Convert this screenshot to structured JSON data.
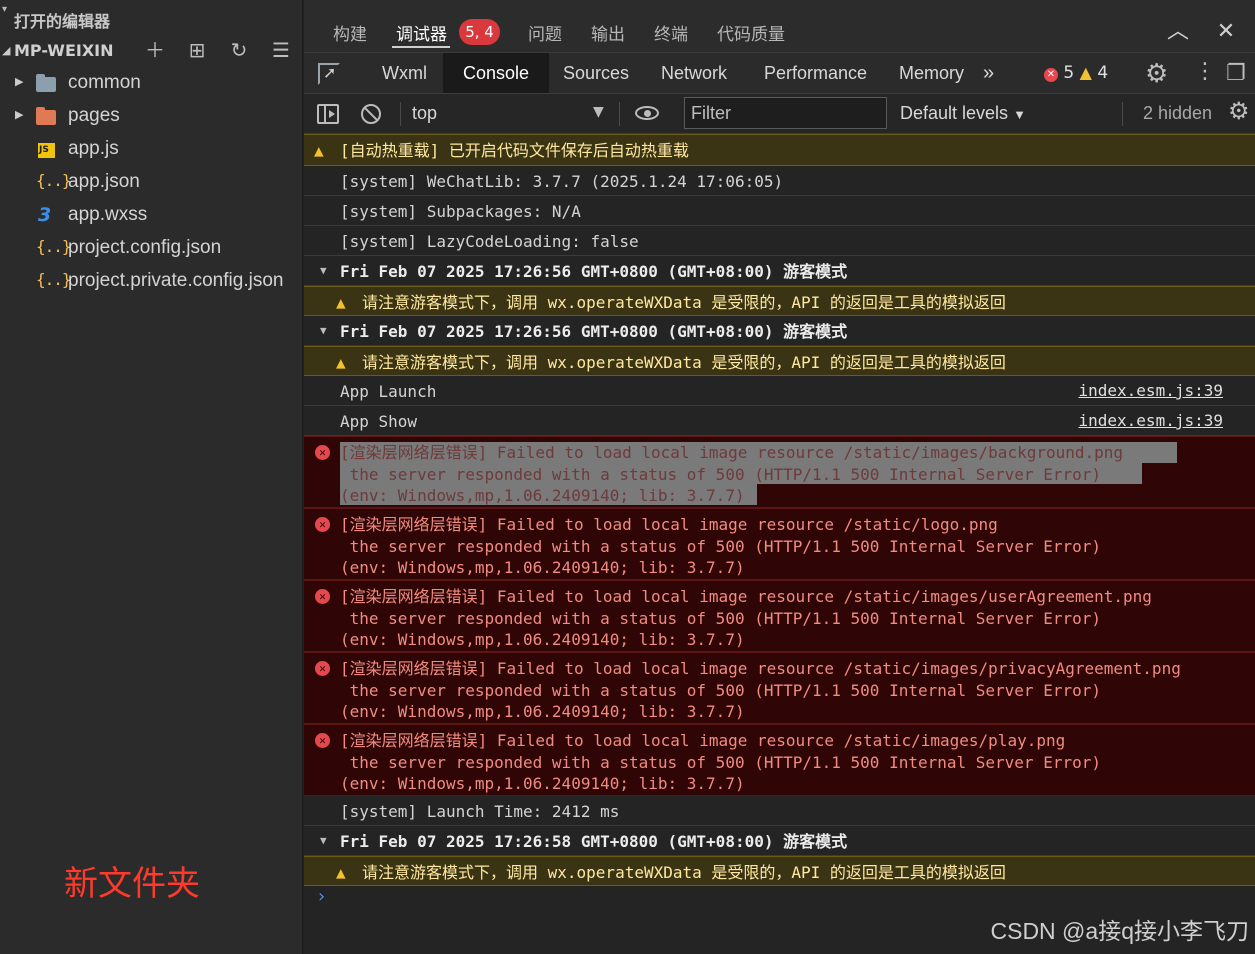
{
  "explorer": {
    "section_title": "打开的编辑器",
    "project_name": "MP-WEIXIN",
    "items": [
      {
        "label": "common",
        "icon": "folder-icon"
      },
      {
        "label": "pages",
        "icon": "folder-pages-icon"
      },
      {
        "label": "app.js",
        "icon": "js-file-icon"
      },
      {
        "label": "app.json",
        "icon": "json-file-icon"
      },
      {
        "label": "app.wxss",
        "icon": "css-file-icon"
      },
      {
        "label": "project.config.json",
        "icon": "json-file-icon"
      },
      {
        "label": "project.private.config.json",
        "icon": "json-file-icon"
      }
    ],
    "new_folder_text": "新文件夹"
  },
  "panel_tabs": {
    "items": [
      "构建",
      "调试器",
      "问题",
      "输出",
      "终端",
      "代码质量"
    ],
    "active": "调试器",
    "badge": "5, 4"
  },
  "devtools_tabs": {
    "items": [
      "Wxml",
      "Console",
      "Sources",
      "Network",
      "Performance",
      "Memory"
    ],
    "active": "Console",
    "more": "»",
    "error_count": "5",
    "warning_count": "4"
  },
  "console_toolbar": {
    "context": "top",
    "filter_placeholder": "Filter",
    "levels": "Default levels",
    "hidden": "2 hidden"
  },
  "console": {
    "hot_reload": "[自动热重载] 已开启代码文件保存后自动热重载",
    "sys1": "[system] WeChatLib: 3.7.7 (2025.1.24 17:06:05)",
    "sys2": "[system] Subpackages: N/A",
    "sys3": "[system] LazyCodeLoading: false",
    "group1": "Fri Feb 07 2025 17:26:56 GMT+0800 (GMT+08:00) 游客模式",
    "guest_warn1": "请注意游客模式下，调用 wx.operateWXData 是受限的，API 的返回是工具的模拟返回",
    "group2": "Fri Feb 07 2025 17:26:56 GMT+0800 (GMT+08:00) 游客模式",
    "guest_warn2": "请注意游客模式下，调用 wx.operateWXData 是受限的，API 的返回是工具的模拟返回",
    "app_launch": "App Launch",
    "app_show": "App Show",
    "src": "index.esm.js:39",
    "errors": [
      {
        "l1": "[渲染层网络层错误] Failed to load local image resource /static/images/background.png",
        "l2": " the server responded with a status of 500 (HTTP/1.1 500 Internal Server Error)",
        "l3": "(env: Windows,mp,1.06.2409140; lib: 3.7.7)"
      },
      {
        "l1": "[渲染层网络层错误] Failed to load local image resource /static/logo.png",
        "l2": " the server responded with a status of 500 (HTTP/1.1 500 Internal Server Error)",
        "l3": "(env: Windows,mp,1.06.2409140; lib: 3.7.7)"
      },
      {
        "l1": "[渲染层网络层错误] Failed to load local image resource /static/images/userAgreement.png",
        "l2": " the server responded with a status of 500 (HTTP/1.1 500 Internal Server Error)",
        "l3": "(env: Windows,mp,1.06.2409140; lib: 3.7.7)"
      },
      {
        "l1": "[渲染层网络层错误] Failed to load local image resource /static/images/privacyAgreement.png",
        "l2": " the server responded with a status of 500 (HTTP/1.1 500 Internal Server Error)",
        "l3": "(env: Windows,mp,1.06.2409140; lib: 3.7.7)"
      },
      {
        "l1": "[渲染层网络层错误] Failed to load local image resource /static/images/play.png",
        "l2": " the server responded with a status of 500 (HTTP/1.1 500 Internal Server Error)",
        "l3": "(env: Windows,mp,1.06.2409140; lib: 3.7.7)"
      }
    ],
    "launch_time": "[system] Launch Time: 2412 ms",
    "group3": "Fri Feb 07 2025 17:26:58 GMT+0800 (GMT+08:00) 游客模式",
    "guest_warn3": "请注意游客模式下，调用 wx.operateWXData 是受限的，API 的返回是工具的模拟返回",
    "prompt": "›"
  },
  "watermark": "CSDN @a接q接小李飞刀",
  "colors": {
    "error": "#f28b82",
    "warning_bg": "#3b3414",
    "error_bg": "#2f0505",
    "badge": "#d9393c",
    "accent_red": "#ff3a2a"
  }
}
